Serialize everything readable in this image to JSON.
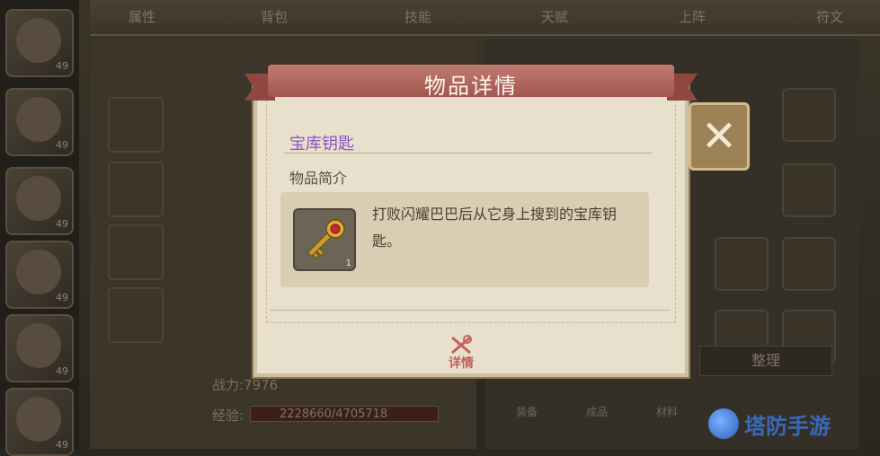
{
  "top_tabs": [
    "属性",
    "背包",
    "技能",
    "天赋",
    "上阵",
    "符文"
  ],
  "hero_levels": [
    "49",
    "49",
    "49",
    "49",
    "49",
    "49"
  ],
  "background": {
    "power_label": "战力:7976",
    "exp_label": "经验:",
    "exp_value": "2228660/4705718",
    "sort_button": "整理",
    "bottom_tabs": [
      "装备",
      "成品",
      "材料"
    ],
    "watermark": "塔防手游"
  },
  "dialog": {
    "title": "物品详情",
    "item_name": "宝库钥匙",
    "section_label": "物品简介",
    "item_quantity": "1",
    "item_description": "打败闪耀巴巴后从它身上搜到的宝库钥匙。",
    "detail_button": "详情",
    "close_icon": "close-x-icon"
  },
  "colors": {
    "item_name": "#8b55c4",
    "banner": "#b0655d",
    "close_button": "#9d8255"
  }
}
